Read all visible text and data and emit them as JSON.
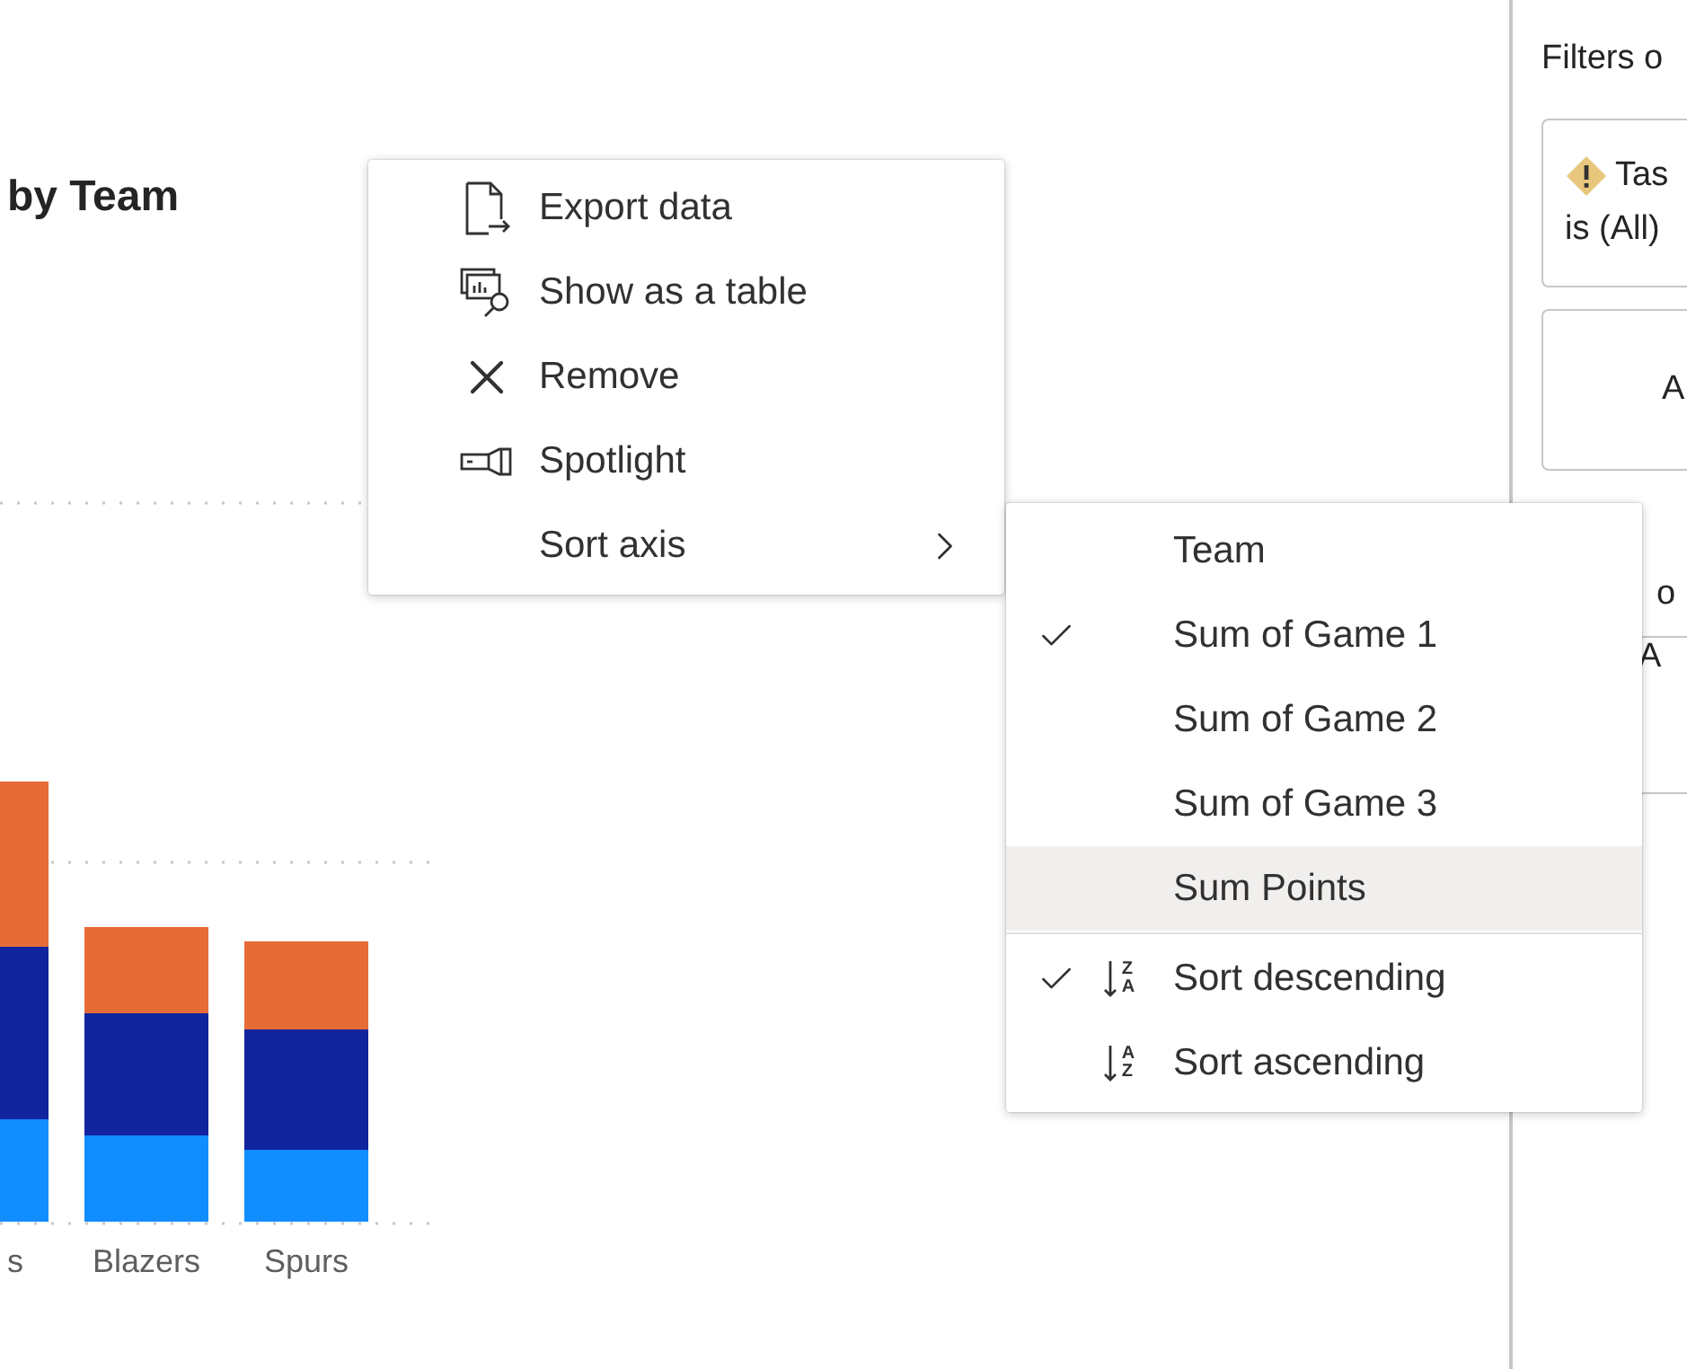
{
  "chart": {
    "title": "by Team",
    "categories": [
      "s",
      "Blazers",
      "Spurs"
    ]
  },
  "context_menu": {
    "items": [
      {
        "label": "Export data",
        "kind": "export",
        "submenu": false
      },
      {
        "label": "Show as a table",
        "kind": "table",
        "submenu": false
      },
      {
        "label": "Remove",
        "kind": "remove",
        "submenu": false
      },
      {
        "label": "Spotlight",
        "kind": "spotlight",
        "submenu": false
      },
      {
        "label": "Sort axis",
        "kind": "plain",
        "submenu": true
      }
    ]
  },
  "sort_menu": {
    "fields": [
      {
        "label": "Team",
        "checked": false,
        "highlighted": false
      },
      {
        "label": "Sum of Game 1",
        "checked": true,
        "highlighted": false
      },
      {
        "label": "Sum of Game 2",
        "checked": false,
        "highlighted": false
      },
      {
        "label": "Sum of Game 3",
        "checked": false,
        "highlighted": false
      },
      {
        "label": "Sum Points",
        "checked": false,
        "highlighted": true
      }
    ],
    "orders": [
      {
        "label": "Sort descending",
        "checked": true,
        "glyph_top": "Z",
        "glyph_bottom": "A"
      },
      {
        "label": "Sort ascending",
        "checked": false,
        "glyph_top": "A",
        "glyph_bottom": "Z"
      }
    ]
  },
  "filters_pane": {
    "title": "Filters o",
    "cards": [
      {
        "kind": "warning",
        "line_1": "Tas",
        "line_2": "is (All)"
      },
      {
        "kind": "plain",
        "line_1": "A"
      }
    ],
    "section_title": "o",
    "section_cards": [
      {
        "kind": "plain",
        "line_1": "A"
      }
    ]
  }
}
